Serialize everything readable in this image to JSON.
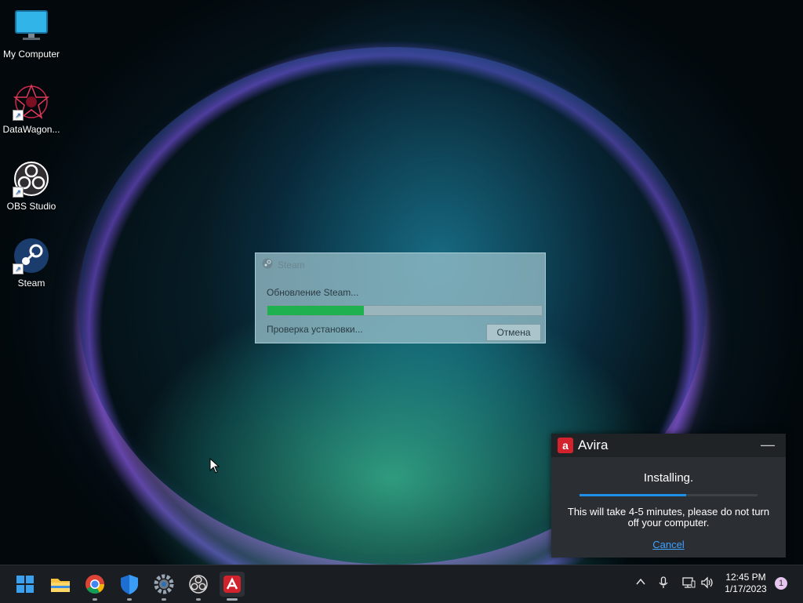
{
  "desktop": {
    "icons": [
      {
        "label": "My Computer",
        "icon": "monitor-icon"
      },
      {
        "label": "DataWagon...",
        "icon": "datawagon-icon"
      },
      {
        "label": "OBS Studio",
        "icon": "obs-icon"
      },
      {
        "label": "Steam",
        "icon": "steam-icon"
      }
    ]
  },
  "steam_dialog": {
    "title": "Steam",
    "message": "Обновление Steam...",
    "progress_fraction": 0.35,
    "status": "Проверка установки...",
    "cancel_label": "Отмена"
  },
  "avira_popup": {
    "title": "Avira",
    "minimize": "—",
    "status": "Installing.",
    "progress_fraction": 0.6,
    "note": "This will take 4-5 minutes, please do not turn off your computer.",
    "cancel_label": "Cancel",
    "accent": "#d2222d"
  },
  "taskbar": {
    "apps": [
      "start-icon",
      "file-explorer-icon",
      "chrome-icon",
      "defender-icon",
      "settings-icon",
      "obs-icon",
      "avira-icon"
    ],
    "tray": [
      "chevron-up-icon",
      "microphone-icon",
      "network-icon",
      "volume-icon"
    ],
    "time": "12:45 PM",
    "date": "1/17/2023",
    "notification_count": "1"
  }
}
